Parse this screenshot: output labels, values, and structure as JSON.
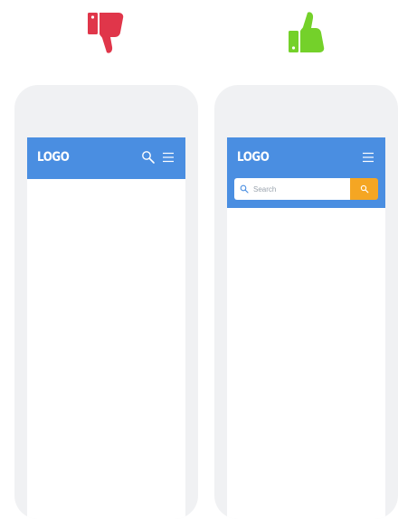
{
  "verdicts": {
    "bad": {
      "icon": "thumbs-down-icon",
      "color": "#e0364a"
    },
    "good": {
      "icon": "thumbs-up-icon",
      "color": "#74d12a"
    }
  },
  "colors": {
    "header": "#4a8ee1",
    "search_button": "#f5a623",
    "phone_frame": "#f0f1f3"
  },
  "bad_example": {
    "logo": "LOGO",
    "icons": [
      "search-icon",
      "menu-icon"
    ]
  },
  "good_example": {
    "logo": "LOGO",
    "icons": [
      "menu-icon"
    ],
    "search": {
      "placeholder": "Search",
      "icon": "search-icon",
      "button_icon": "search-icon"
    }
  }
}
